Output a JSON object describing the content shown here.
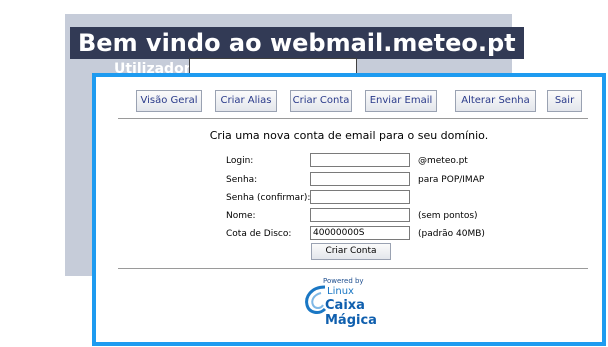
{
  "background": {
    "title": "Bem vindo ao webmail.meteo.pt",
    "user_label": "Utilizador",
    "user_value": ""
  },
  "nav": {
    "items": [
      {
        "label": "Visão Geral"
      },
      {
        "label": "Criar Alias"
      },
      {
        "label": "Criar Conta"
      },
      {
        "label": "Enviar Email"
      },
      {
        "label": "Alterar Senha"
      },
      {
        "label": "Sair"
      }
    ]
  },
  "form": {
    "intro": "Cria uma nova conta de email para o seu domínio.",
    "login_label": "Login:",
    "login_value": "",
    "login_note": "@meteo.pt",
    "senha_label": "Senha:",
    "senha_value": "",
    "senha_note": "para POP/IMAP",
    "senha_confirm_label": "Senha (confirmar):",
    "senha_confirm_value": "",
    "nome_label": "Nome:",
    "nome_value": "",
    "nome_note": "(sem pontos)",
    "cota_label": "Cota de Disco:",
    "cota_value": "40000000S",
    "cota_note": "(padrão 40MB)",
    "submit_label": "Criar Conta"
  },
  "logo": {
    "powered": "Powered by",
    "linux": "Linux",
    "brand": "Caixa Mágica"
  },
  "colors": {
    "accent_border": "#1e9bf0",
    "title_bg": "#323a55",
    "page_bg": "#c6ccd9"
  }
}
